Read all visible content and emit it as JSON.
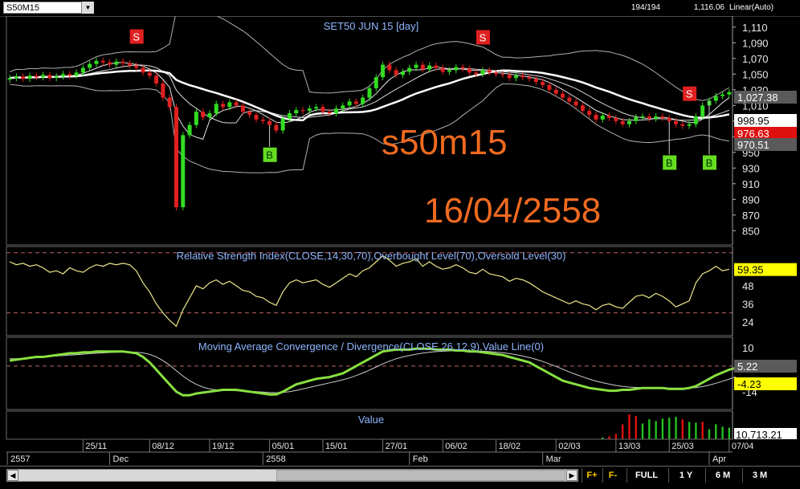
{
  "header": {
    "symbol": "S50M15",
    "dropdown_icon": "chevron-down-icon",
    "bars_shown": "194/194",
    "last_price": "1,116.06",
    "scale_mode": "Linear(Auto)"
  },
  "watermark": {
    "name": "s50m15",
    "date": "16/04/2558"
  },
  "chart_data": [
    {
      "type": "candlestick",
      "title": "SET50 JUN 15    [day]",
      "ylim": [
        838,
        1118
      ],
      "y_ticks": [
        "1,110",
        "1,090",
        "1,070",
        "1,050",
        "1,030",
        "1,010",
        "990",
        "970",
        "950",
        "930",
        "910",
        "890",
        "870",
        "850"
      ],
      "price_tags": [
        {
          "label": "1,027.38",
          "color": "#5a5a5a"
        },
        {
          "label": "998.95",
          "color": "#ffffff"
        },
        {
          "label": "976.63",
          "color": "#e01010"
        },
        {
          "label": "970.51",
          "color": "#5a5a5a"
        }
      ],
      "signals": [
        {
          "type": "S",
          "index": 19,
          "value": 1098,
          "color": "#e02020"
        },
        {
          "type": "B",
          "index": 39,
          "value": 947,
          "color": "#66dd22"
        },
        {
          "type": "S",
          "index": 71,
          "value": 1097,
          "color": "#e02020"
        },
        {
          "type": "S",
          "index": 102,
          "value": 1025,
          "color": "#e02020"
        },
        {
          "type": "B",
          "index": 99,
          "value": 937,
          "color": "#66dd22"
        },
        {
          "type": "B",
          "index": 105,
          "value": 937,
          "color": "#66dd22"
        }
      ],
      "closes": [
        1045,
        1047,
        1044,
        1048,
        1046,
        1049,
        1045,
        1047,
        1050,
        1048,
        1052,
        1058,
        1063,
        1067,
        1065,
        1062,
        1066,
        1064,
        1061,
        1058,
        1052,
        1048,
        1038,
        1020,
        1008,
        880,
        972,
        985,
        1002,
        995,
        1000,
        1012,
        1008,
        1014,
        1010,
        1002,
        998,
        992,
        990,
        985,
        978,
        993,
        1000,
        1004,
        1003,
        1006,
        1008,
        1002,
        1000,
        1006,
        1010,
        1015,
        1012,
        1020,
        1032,
        1046,
        1062,
        1055,
        1049,
        1053,
        1058,
        1062,
        1056,
        1061,
        1058,
        1053,
        1055,
        1059,
        1057,
        1052,
        1050,
        1055,
        1052,
        1050,
        1049,
        1045,
        1048,
        1046,
        1044,
        1040,
        1036,
        1030,
        1025,
        1020,
        1015,
        1010,
        1003,
        998,
        992,
        997,
        994,
        990,
        986,
        990,
        995,
        996,
        993,
        996,
        994,
        990,
        986,
        984,
        986,
        996,
        1010,
        1016,
        1022,
        1024,
        1027
      ]
    },
    {
      "type": "line",
      "title": "Relative Strength Index(CLOSE,14,30,70),Overbought Level(70),Oversold Level(30)",
      "ylim": [
        17,
        72
      ],
      "overbought": 70,
      "oversold": 30,
      "y_ticks": [
        "60",
        "48",
        "36",
        "24"
      ],
      "value_tag": "59.35",
      "values": [
        64,
        62,
        63,
        61,
        62,
        60,
        57,
        58,
        56,
        60,
        58,
        57,
        60,
        62,
        61,
        63,
        62,
        63,
        62,
        58,
        50,
        44,
        36,
        30,
        25,
        21,
        32,
        40,
        48,
        46,
        50,
        52,
        49,
        51,
        48,
        45,
        44,
        41,
        40,
        37,
        35,
        44,
        50,
        52,
        50,
        51,
        52,
        49,
        47,
        50,
        53,
        56,
        54,
        58,
        60,
        64,
        68,
        65,
        61,
        63,
        64,
        66,
        61,
        64,
        61,
        59,
        60,
        62,
        60,
        57,
        56,
        59,
        56,
        55,
        54,
        51,
        53,
        52,
        50,
        47,
        44,
        42,
        40,
        38,
        36,
        38,
        36,
        35,
        32,
        35,
        36,
        34,
        33,
        37,
        41,
        42,
        40,
        43,
        41,
        38,
        34,
        36,
        38,
        50,
        56,
        58,
        61,
        58,
        59
      ]
    },
    {
      "type": "line",
      "title": "Moving Average Convergence / Divergence(CLOSE,26,12,9),Value Line(0)",
      "ylim": [
        -22,
        14
      ],
      "y_ticks": [
        "10",
        "5.22",
        "-4.23",
        "-14"
      ],
      "value_tags": [
        {
          "label": "5.22",
          "color": "#5a5a5a"
        },
        {
          "label": "-4.23",
          "color": "#ffff00"
        }
      ],
      "series": [
        {
          "name": "MACD",
          "color": "#88e040",
          "values": [
            3,
            3.5,
            4,
            4.5,
            5,
            5,
            5.5,
            6,
            6.5,
            7,
            7,
            7.5,
            7.5,
            8,
            8,
            8,
            8,
            8,
            7.5,
            7,
            5,
            2,
            -2,
            -6,
            -10,
            -14,
            -16,
            -16,
            -15,
            -14.5,
            -14,
            -13.5,
            -13,
            -13,
            -13,
            -13.5,
            -14,
            -14.5,
            -15,
            -15.5,
            -15.5,
            -14,
            -12,
            -10,
            -9,
            -8,
            -7,
            -6.5,
            -6,
            -5,
            -4,
            -2,
            0,
            2,
            4,
            6,
            8,
            8.5,
            9,
            9,
            9,
            9.5,
            9.5,
            9.5,
            9,
            9,
            9,
            8.5,
            8.5,
            8,
            8,
            7.5,
            7,
            6.5,
            6,
            5,
            4,
            3,
            2,
            0,
            -2,
            -4,
            -6,
            -8,
            -9,
            -10,
            -11,
            -12,
            -12.5,
            -13,
            -13.5,
            -13.5,
            -13,
            -13,
            -12.5,
            -12,
            -12,
            -12,
            -12,
            -12.5,
            -12.5,
            -12.5,
            -12,
            -11,
            -9,
            -7,
            -5,
            -3.5,
            -2,
            -1
          ]
        },
        {
          "name": "Signal",
          "color": "#cccccc",
          "values": [
            4,
            4,
            4.2,
            4.5,
            4.8,
            5,
            5.2,
            5.5,
            5.8,
            6,
            6.2,
            6.5,
            6.8,
            7,
            7.2,
            7.4,
            7.6,
            7.7,
            7.7,
            7.6,
            7.2,
            6.4,
            5,
            3,
            0.5,
            -2.5,
            -5.5,
            -8,
            -10,
            -11.5,
            -12.5,
            -13,
            -13.2,
            -13.4,
            -13.5,
            -13.6,
            -13.8,
            -14,
            -14.2,
            -14.5,
            -14.6,
            -14.4,
            -14,
            -13.3,
            -12.5,
            -11.7,
            -10.8,
            -10,
            -9.2,
            -8.4,
            -7.5,
            -6.5,
            -5.2,
            -3.8,
            -2.2,
            -0.5,
            1.2,
            2.7,
            4,
            5,
            5.8,
            6.5,
            7.1,
            7.6,
            7.9,
            8.1,
            8.3,
            8.4,
            8.4,
            8.4,
            8.3,
            8.1,
            7.9,
            7.6,
            7.3,
            6.8,
            6.2,
            5.5,
            4.7,
            3.7,
            2.5,
            1.2,
            -0.2,
            -1.7,
            -3.2,
            -4.6,
            -5.9,
            -7.1,
            -8.2,
            -9.1,
            -9.9,
            -10.6,
            -11.1,
            -11.5,
            -11.7,
            -11.8,
            -11.9,
            -11.9,
            -11.9,
            -12,
            -12.1,
            -12.1,
            -12,
            -11.8,
            -11.2,
            -10.4,
            -9.4,
            -8.3,
            -7.1,
            -5.9
          ]
        }
      ]
    },
    {
      "type": "bar",
      "title": "Value",
      "value_tag": "10,713.21",
      "ylim": [
        0,
        32000
      ],
      "start_index": 89,
      "values": [
        2000,
        3500,
        6500,
        18000,
        30000,
        28000,
        19000,
        24000,
        22000,
        25000,
        26000,
        27000,
        24000,
        21000,
        20000,
        21000,
        12000,
        18000,
        15000,
        14000
      ],
      "colors": [
        "#22c020",
        "#e01010",
        "#e01010",
        "#e01010",
        "#e01010",
        "#e01010",
        "#22c020",
        "#22c020",
        "#22c020",
        "#22c020",
        "#22c020",
        "#22c020",
        "#e01010",
        "#22c020",
        "#22c020",
        "#e01010",
        "#22c020",
        "#22c020",
        "#22c020",
        "#22c020"
      ]
    }
  ],
  "time_axis": {
    "dates": [
      {
        "label": "25/11",
        "index": 11
      },
      {
        "label": "08/12",
        "index": 21
      },
      {
        "label": "19/12",
        "index": 30
      },
      {
        "label": "05/01",
        "index": 39
      },
      {
        "label": "15/01",
        "index": 47
      },
      {
        "label": "27/01",
        "index": 56
      },
      {
        "label": "06/02",
        "index": 65
      },
      {
        "label": "18/02",
        "index": 73
      },
      {
        "label": "02/03",
        "index": 82
      },
      {
        "label": "13/03",
        "index": 91
      },
      {
        "label": "25/03",
        "index": 99
      },
      {
        "label": "07/04",
        "index": 108
      }
    ],
    "months": [
      {
        "label": "2557",
        "index": 0
      },
      {
        "label": "Dec",
        "index": 15
      },
      {
        "label": "2558",
        "index": 38
      },
      {
        "label": "Feb",
        "index": 60
      },
      {
        "label": "Mar",
        "index": 80
      },
      {
        "label": "Apr",
        "index": 105
      }
    ]
  },
  "toolbar": {
    "f_plus": "F+",
    "f_minus": "F-",
    "ranges": [
      "FULL",
      "1 Y",
      "6 M",
      "3 M"
    ],
    "scroll_left_icon": "triangle-left-icon",
    "scroll_right_icon": "triangle-right-icon"
  }
}
